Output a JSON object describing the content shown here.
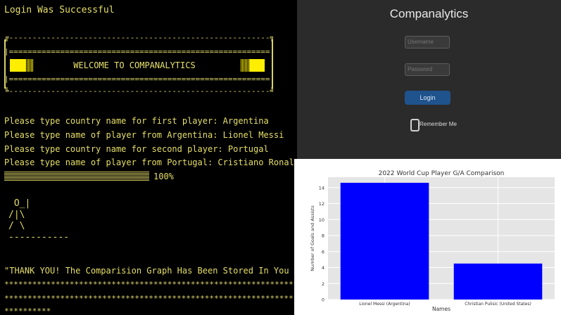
{
  "terminal": {
    "success_line": "Login Was Successful",
    "banner_top": "╔--------------------------------------------------------╗",
    "banner_eq": "|========================================================|",
    "banner_bottom": "╚--------------------------------------------------------╝",
    "welcome": "WELCOME TO COMPANALYTICS",
    "prompts": [
      "Please type country name for first player: Argentina",
      "Please type name of player from Argentina: Lionel Messi",
      "Please type country name for second player: Portugal",
      "Please type name of player from Portugal: Cristiano Ronaldo"
    ],
    "progress_percent": "100%",
    "progress_value": 100,
    "stickman": " O_|\n/|\\\n/ \\\n-----------",
    "thanks": "\"THANK YOU! The Comparision Graph Has Been Stored In You PC\"",
    "stars_long": "********************************************************************",
    "stars_short": "**********"
  },
  "login": {
    "title": "Companalytics",
    "username_placeholder": "Username",
    "password_placeholder": "Password",
    "login_label": "Login",
    "remember_label": "Remember Me",
    "accent": "#1f538d"
  },
  "chart_data": {
    "type": "bar",
    "title": "2022 World Cup Player G/A Comparison",
    "xlabel": "Names",
    "ylabel": "Number of Goals and Assists",
    "categories": [
      "Lionel Messi (Argentina)",
      "Christian Pulisic (United States)"
    ],
    "values": [
      14.6,
      4.5
    ],
    "ylim": [
      0,
      15.3
    ],
    "yticks": [
      0,
      2,
      4,
      6,
      8,
      10,
      12,
      14
    ],
    "bar_color": "#0000ff",
    "grid": true,
    "background": "#e5e5e5"
  }
}
